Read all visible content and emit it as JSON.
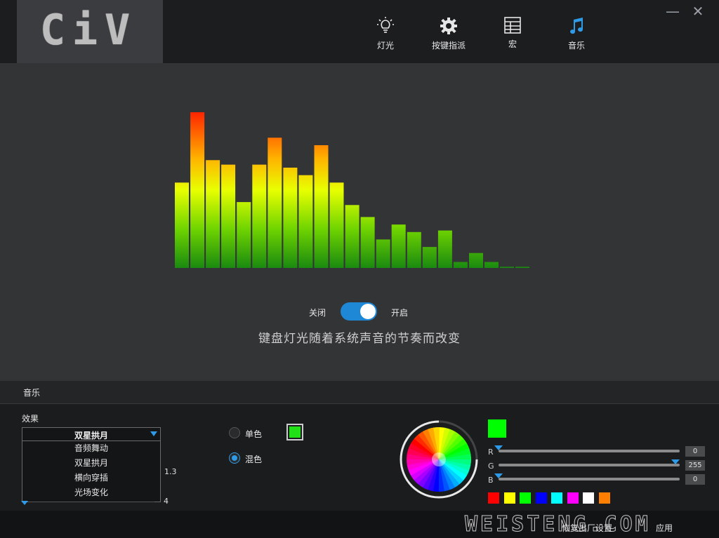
{
  "header": {
    "logo": "CiV",
    "nav": [
      {
        "label": "灯光",
        "icon": "lightbulb-icon"
      },
      {
        "label": "按键指派",
        "icon": "gear-icon"
      },
      {
        "label": "宏",
        "icon": "table-grid-icon"
      },
      {
        "label": "音乐",
        "icon": "music-note-icon",
        "active": true
      }
    ],
    "minimize": "—",
    "close": "✕"
  },
  "equalizer": {
    "levels": [
      57,
      104,
      72,
      69,
      44,
      69,
      87,
      67,
      62,
      82,
      57,
      42,
      34,
      19,
      29,
      24,
      14,
      25,
      4,
      10,
      4,
      0.8,
      0.8
    ],
    "max_level": 104
  },
  "music_toggle": {
    "off_label": "关闭",
    "on_label": "开启",
    "state": "on"
  },
  "description": "键盘灯光随着系统声音的节奏而改变",
  "section_title": "音乐",
  "effects": {
    "label": "效果",
    "selected": "双星拱月",
    "options": [
      "音频舞动",
      "双星拱月",
      "横向穿插",
      "光场变化"
    ],
    "speed_value": "1.3",
    "brightness_value": "4"
  },
  "color_mode": {
    "single_label": "单色",
    "mixed_label": "混色",
    "selected": "mixed",
    "single_color": "#22e016"
  },
  "color_picker": {
    "preview": "#00ff00",
    "channels": [
      {
        "label": "R",
        "value": "0"
      },
      {
        "label": "G",
        "value": "255"
      },
      {
        "label": "B",
        "value": "0"
      }
    ],
    "presets": [
      "#ff0000",
      "#ffff00",
      "#00ff00",
      "#0000ff",
      "#00ffff",
      "#ff00ff",
      "#ffffff",
      "#ff8000"
    ]
  },
  "footer": {
    "watermark": "WEISTENG.COM",
    "reset_label": "恢复出厂设置",
    "apply_label": "应用"
  }
}
